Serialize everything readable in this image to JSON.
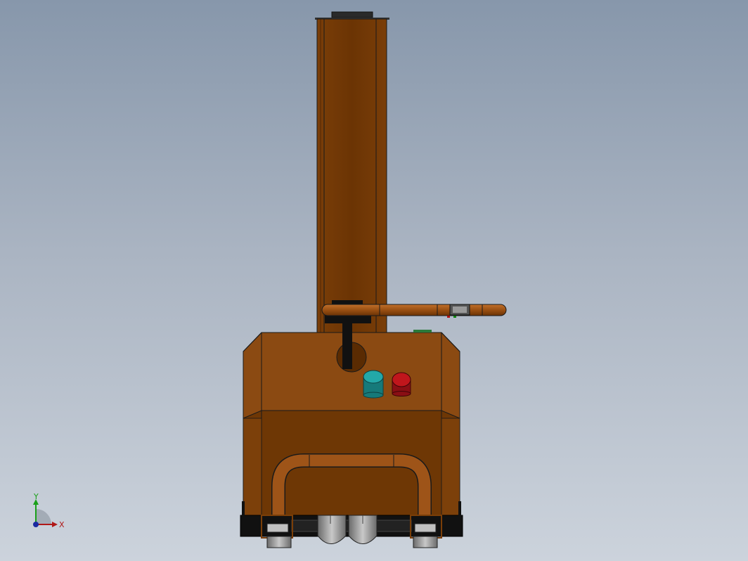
{
  "view": {
    "title": "",
    "triad": {
      "x_label": "X",
      "y_label": "Y"
    }
  },
  "colors": {
    "background_top": "#8797ab",
    "background_bottom": "#ccd3dc",
    "body_orange": "#8b4a12",
    "body_dark": "#6e3705",
    "outline": "#1a1a1a",
    "start_button": "#1f9a9a",
    "stop_button": "#b0141a",
    "wheel_gray": "#9a9a9a"
  },
  "icons": {
    "triad": "coordinate-axes-icon"
  }
}
